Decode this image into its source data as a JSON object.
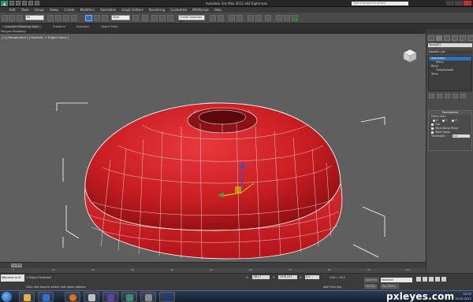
{
  "window": {
    "title": "Autodesk 3ds Max 2012 x64     Eight.max",
    "search_placeholder": "Type a keyword or phrase"
  },
  "menu": [
    "Edit",
    "Tools",
    "Group",
    "Views",
    "Create",
    "Modifiers",
    "Animation",
    "Graph Editors",
    "Rendering",
    "Customize",
    "MAXScript",
    "Help"
  ],
  "toolbar": {
    "view_select": "View",
    "selection_set": "Create Selection Se"
  },
  "ribbon": {
    "tabs": [
      "Graphite Modeling Tools",
      "Freeform",
      "Selection",
      "Object Paint"
    ],
    "sub": "Polygon Modeling"
  },
  "viewport": {
    "label": "[+] [Perspective ] [ Realistic + Edged Faces ]"
  },
  "command_panel": {
    "object_name": "Torus001",
    "modifier_list": "Modifier List",
    "stack": [
      "Symmetry",
      "Mirror",
      "Bend",
      "TurboSmooth",
      "Torus"
    ],
    "parameters": {
      "header": "Parameters",
      "mirror_axis": "Mirror Axis:",
      "axes": [
        "X",
        "Y",
        "Z"
      ],
      "flip": "Flip",
      "slice": "Slice Along Mirror",
      "weld": "Weld Seam",
      "threshold_label": "Threshold:",
      "threshold_value": "0.0"
    }
  },
  "timeline": {
    "frame": "0 / 100",
    "ticks": [
      "0",
      "10",
      "20",
      "30",
      "40",
      "50",
      "60",
      "70",
      "80",
      "90",
      "100"
    ]
  },
  "status": {
    "minilistener": "Welcome to M",
    "selected": "1 Object Selected",
    "prompt": "Click and drag to select and move objects",
    "x_label": "X:",
    "x_value": "-581,7",
    "y_label": "Y:",
    "y_value": "-1978,211",
    "z_label": "Z:",
    "z_value": "0,0",
    "grid": "Grid = 10,0",
    "add_time_tag": "Add Time Tag",
    "auto_key": "Auto Key",
    "set_key": "Set Key",
    "key_filters": "Key Filters...",
    "selected_dropdown": "Selected"
  },
  "taskbar": {
    "time": "10:37",
    "date": "30.05.2012"
  },
  "watermark": "pxleyes.com",
  "colors": {
    "viewport_bg": "#5f5f5f",
    "mesh_fill": "#cc1f24",
    "selection_blue": "#2f6fb5"
  }
}
